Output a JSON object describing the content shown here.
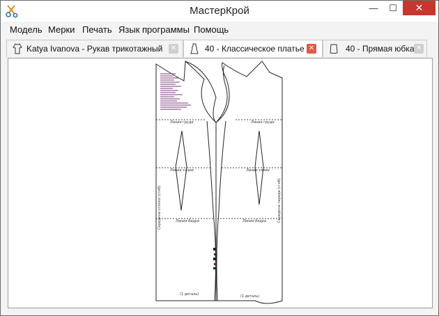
{
  "window": {
    "title": "МастерКрой",
    "minimize_glyph": "—",
    "maximize_glyph": "☐",
    "close_glyph": "✕"
  },
  "menu": {
    "items": [
      {
        "label": "Модель"
      },
      {
        "label": "Мерки"
      },
      {
        "label": "Печать"
      },
      {
        "label": "Язык программы"
      },
      {
        "label": "Помощь"
      }
    ]
  },
  "tabs": [
    {
      "label": "Katya Ivanova - Рукав трикотажный",
      "icon": "sleeve-icon",
      "active": false
    },
    {
      "label": "40 - Классическое платье",
      "icon": "dress-icon",
      "active": true
    },
    {
      "label": "40 - Прямая юбка",
      "icon": "skirt-icon",
      "active": false
    }
  ],
  "tab_close_glyph": "✕",
  "pattern": {
    "labels": {
      "chest_left": "Линия груди",
      "chest_right": "Линия груди",
      "waist_left": "Линия талии",
      "waist_right": "Линия талии",
      "hip_left": "Линия бедра",
      "hip_right": "Линия бедра",
      "piece_left": "(1 деталь)",
      "piece_right": "(1 деталь)",
      "grain_left": "Середина спинки (сгиб)",
      "grain_right": "Середина переда (сгиб)"
    }
  }
}
